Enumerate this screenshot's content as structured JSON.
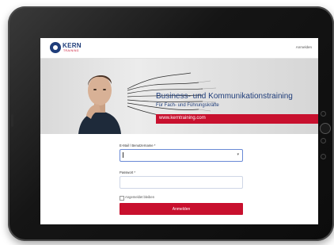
{
  "brand": {
    "name": "KERN",
    "subtitle": "TRAINING"
  },
  "topbar": {
    "login_link": "Anmelden"
  },
  "hero": {
    "headline": "Business- und Kommunikationstraining",
    "subline": "Für Fach- und Führungskräfte",
    "url": "www.kerntraining.com"
  },
  "form": {
    "username_label": "E-Mail / Benutzername *",
    "username_value": "",
    "password_label": "Passwort *",
    "password_value": "",
    "remember_label": "Angemeldet bleiben",
    "remember_checked": false,
    "submit_label": "Anmelden"
  },
  "colors": {
    "brand_blue": "#1f3d7a",
    "brand_red": "#c8102e"
  }
}
